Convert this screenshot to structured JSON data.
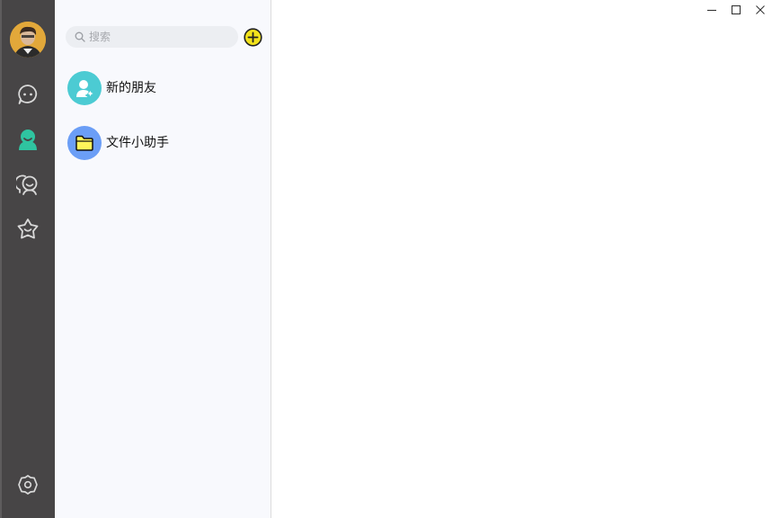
{
  "sidebar": {
    "avatar_icon": "user-avatar",
    "nav": [
      {
        "id": "chat",
        "icon": "chat-bubble-icon",
        "active": false
      },
      {
        "id": "contacts",
        "icon": "contacts-person-icon",
        "active": true,
        "color": "#2fc4a0"
      },
      {
        "id": "moments",
        "icon": "friends-group-icon",
        "active": false
      },
      {
        "id": "favorites",
        "icon": "star-box-icon",
        "active": false
      }
    ],
    "settings_icon": "gear-icon"
  },
  "search": {
    "placeholder": "搜索"
  },
  "add_button": {
    "icon": "plus-circle-icon",
    "color": "#f2e21b"
  },
  "contacts": [
    {
      "label": "新的朋友",
      "icon": "add-person-icon",
      "color": "#4ccbd3"
    },
    {
      "label": "文件小助手",
      "icon": "folder-icon",
      "color": "#6b9ef6"
    }
  ],
  "window_controls": [
    "minimize-icon",
    "maximize-icon",
    "close-icon"
  ]
}
